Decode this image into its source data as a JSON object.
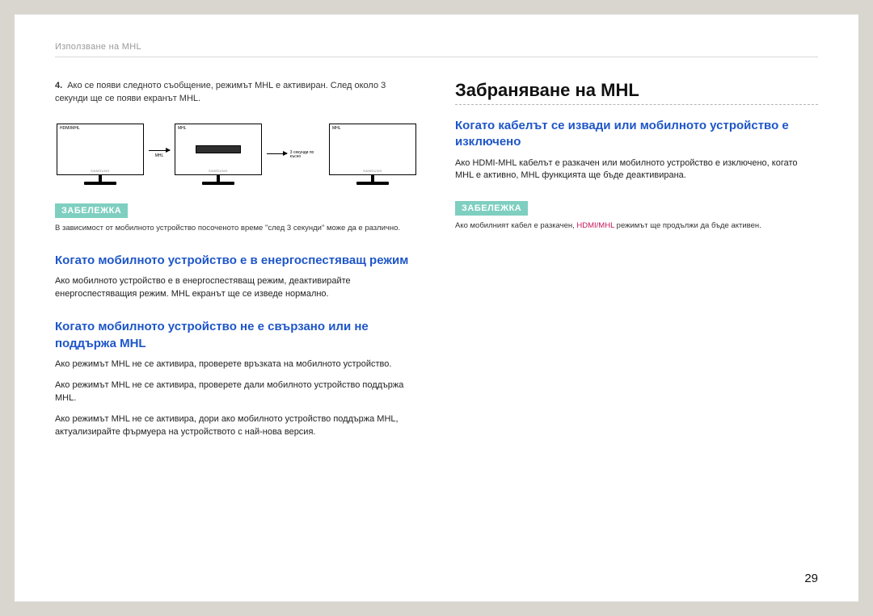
{
  "header": {
    "breadcrumb": "Използване на MHL"
  },
  "left": {
    "step4": {
      "num": "4.",
      "text": "Ако се появи следното съобщение, режимът MHL е активиран. След около 3 секунди ще се появи екранът MHL."
    },
    "monitors": {
      "m1_label": "HDMI/MHL",
      "m2_label": "MHL",
      "m3_label": "MHL",
      "arrow1_label": "MHL",
      "arrow2_label": "3 секунди по късно",
      "brand": "SAMSUNG"
    },
    "note1": {
      "badge": "ЗАБЕЛЕЖКА",
      "text": "В зависимост от мобилното устройство посоченото време \"след 3 секунди\" може да е различно."
    },
    "sec1": {
      "title": "Когато мобилното устройство е в енергоспестяващ режим",
      "p1": "Ако мобилното устройство е в енергоспестяващ режим, деактивирайте енергоспестяващия режим. MHL екранът ще се изведе нормално."
    },
    "sec2": {
      "title": "Когато мобилното устройство не е свързано или не поддържа MHL",
      "p1": "Ако режимът MHL не се активира, проверете връзката на мобилното устройство.",
      "p2": "Ако режимът MHL не се активира, проверете дали мобилното устройство поддържа MHL.",
      "p3": "Ако режимът MHL не се активира, дори ако мобилното устройство поддържа MHL, актуализирайте фърмуера на устройството с най-нова версия."
    }
  },
  "right": {
    "title": "Забраняване на MHL",
    "sec": {
      "title": "Когато кабелът се извади или мобилното устройство е изключено",
      "p1": "Ако HDMI-MHL кабелът е разкачен или мобилното устройство е изключено, когато MHL е активно, MHL функцията ще бъде деактивирана."
    },
    "note": {
      "badge": "ЗАБЕЛЕЖКА",
      "pre": "Ако мобилният кабел е разкачен, ",
      "hl": "HDMI/MHL",
      "post": " режимът ще продължи да бъде активен."
    }
  },
  "page_number": "29"
}
